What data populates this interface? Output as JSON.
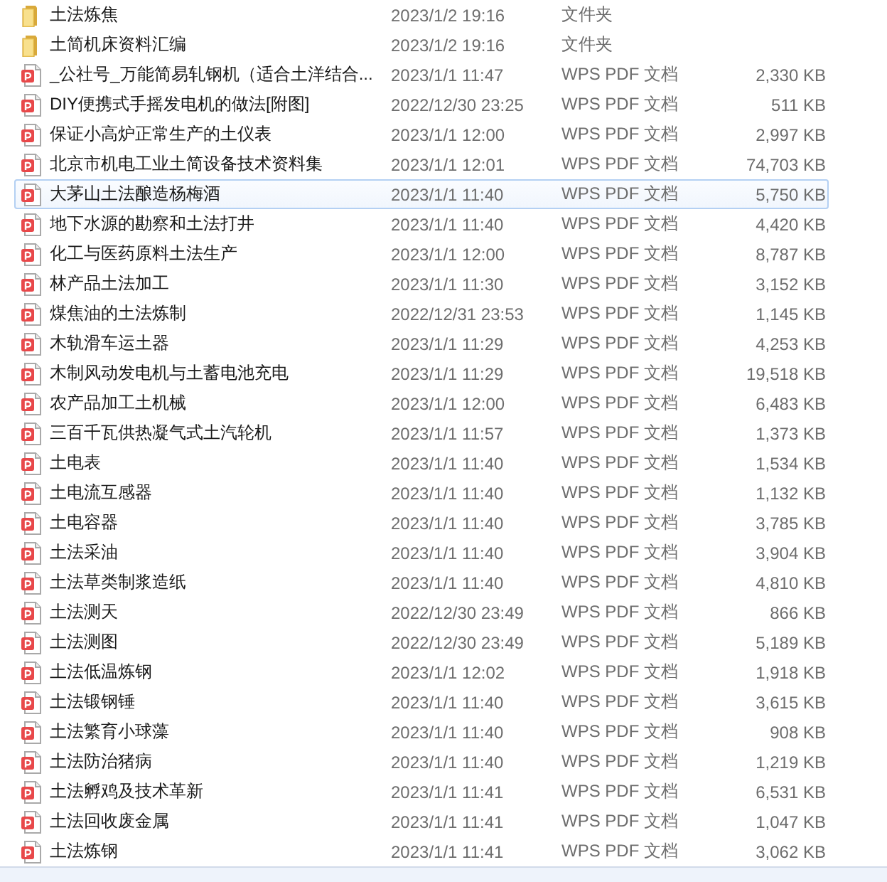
{
  "files": [
    {
      "kind": "folder",
      "name": "土法炼焦",
      "modified": "2023/1/2 19:16",
      "type": "文件夹",
      "selected": false
    },
    {
      "kind": "folder",
      "name": "土简机床资料汇编",
      "modified": "2023/1/2 19:16",
      "type": "文件夹",
      "selected": false
    },
    {
      "kind": "pdf",
      "name": "_公社号_万能简易轧钢机（适合土洋结合...",
      "modified": "2023/1/1 11:47",
      "type": "WPS PDF 文档",
      "size": "2,330 KB",
      "selected": false
    },
    {
      "kind": "pdf",
      "name": "DIY便携式手摇发电机的做法[附图]",
      "modified": "2022/12/30 23:25",
      "type": "WPS PDF 文档",
      "size": "511 KB",
      "selected": false
    },
    {
      "kind": "pdf",
      "name": "保证小高炉正常生产的土仪表",
      "modified": "2023/1/1 12:00",
      "type": "WPS PDF 文档",
      "size": "2,997 KB",
      "selected": false
    },
    {
      "kind": "pdf",
      "name": "北京市机电工业土简设备技术资料集",
      "modified": "2023/1/1 12:01",
      "type": "WPS PDF 文档",
      "size": "74,703 KB",
      "selected": false
    },
    {
      "kind": "pdf",
      "name": "大茅山土法酿造杨梅酒",
      "modified": "2023/1/1 11:40",
      "type": "WPS PDF 文档",
      "size": "5,750 KB",
      "selected": true
    },
    {
      "kind": "pdf",
      "name": "地下水源的勘察和土法打井",
      "modified": "2023/1/1 11:40",
      "type": "WPS PDF 文档",
      "size": "4,420 KB",
      "selected": false
    },
    {
      "kind": "pdf",
      "name": "化工与医药原料土法生产",
      "modified": "2023/1/1 12:00",
      "type": "WPS PDF 文档",
      "size": "8,787 KB",
      "selected": false
    },
    {
      "kind": "pdf",
      "name": "林产品土法加工",
      "modified": "2023/1/1 11:30",
      "type": "WPS PDF 文档",
      "size": "3,152 KB",
      "selected": false
    },
    {
      "kind": "pdf",
      "name": "煤焦油的土法炼制",
      "modified": "2022/12/31 23:53",
      "type": "WPS PDF 文档",
      "size": "1,145 KB",
      "selected": false
    },
    {
      "kind": "pdf",
      "name": "木轨滑车运土器",
      "modified": "2023/1/1 11:29",
      "type": "WPS PDF 文档",
      "size": "4,253 KB",
      "selected": false
    },
    {
      "kind": "pdf",
      "name": "木制风动发电机与土蓄电池充电",
      "modified": "2023/1/1 11:29",
      "type": "WPS PDF 文档",
      "size": "19,518 KB",
      "selected": false
    },
    {
      "kind": "pdf",
      "name": "农产品加工土机械",
      "modified": "2023/1/1 12:00",
      "type": "WPS PDF 文档",
      "size": "6,483 KB",
      "selected": false
    },
    {
      "kind": "pdf",
      "name": "三百千瓦供热凝气式土汽轮机",
      "modified": "2023/1/1 11:57",
      "type": "WPS PDF 文档",
      "size": "1,373 KB",
      "selected": false
    },
    {
      "kind": "pdf",
      "name": "土电表",
      "modified": "2023/1/1 11:40",
      "type": "WPS PDF 文档",
      "size": "1,534 KB",
      "selected": false
    },
    {
      "kind": "pdf",
      "name": "土电流互感器",
      "modified": "2023/1/1 11:40",
      "type": "WPS PDF 文档",
      "size": "1,132 KB",
      "selected": false
    },
    {
      "kind": "pdf",
      "name": "土电容器",
      "modified": "2023/1/1 11:40",
      "type": "WPS PDF 文档",
      "size": "3,785 KB",
      "selected": false
    },
    {
      "kind": "pdf",
      "name": "土法采油",
      "modified": "2023/1/1 11:40",
      "type": "WPS PDF 文档",
      "size": "3,904 KB",
      "selected": false
    },
    {
      "kind": "pdf",
      "name": "土法草类制浆造纸",
      "modified": "2023/1/1 11:40",
      "type": "WPS PDF 文档",
      "size": "4,810 KB",
      "selected": false
    },
    {
      "kind": "pdf",
      "name": "土法测天",
      "modified": "2022/12/30 23:49",
      "type": "WPS PDF 文档",
      "size": "866 KB",
      "selected": false
    },
    {
      "kind": "pdf",
      "name": "土法测图",
      "modified": "2022/12/30 23:49",
      "type": "WPS PDF 文档",
      "size": "5,189 KB",
      "selected": false
    },
    {
      "kind": "pdf",
      "name": "土法低温炼钢",
      "modified": "2023/1/1 12:02",
      "type": "WPS PDF 文档",
      "size": "1,918 KB",
      "selected": false
    },
    {
      "kind": "pdf",
      "name": "土法锻钢锤",
      "modified": "2023/1/1 11:40",
      "type": "WPS PDF 文档",
      "size": "3,615 KB",
      "selected": false
    },
    {
      "kind": "pdf",
      "name": "土法繁育小球藻",
      "modified": "2023/1/1 11:40",
      "type": "WPS PDF 文档",
      "size": "908 KB",
      "selected": false
    },
    {
      "kind": "pdf",
      "name": "土法防治猪病",
      "modified": "2023/1/1 11:40",
      "type": "WPS PDF 文档",
      "size": "1,219 KB",
      "selected": false
    },
    {
      "kind": "pdf",
      "name": "土法孵鸡及技术革新",
      "modified": "2023/1/1 11:41",
      "type": "WPS PDF 文档",
      "size": "6,531 KB",
      "selected": false
    },
    {
      "kind": "pdf",
      "name": "土法回收废金属",
      "modified": "2023/1/1 11:41",
      "type": "WPS PDF 文档",
      "size": "1,047 KB",
      "selected": false
    },
    {
      "kind": "pdf",
      "name": "土法炼钢",
      "modified": "2023/1/1 11:41",
      "type": "WPS PDF 文档",
      "size": "3,062 KB",
      "selected": false
    }
  ]
}
